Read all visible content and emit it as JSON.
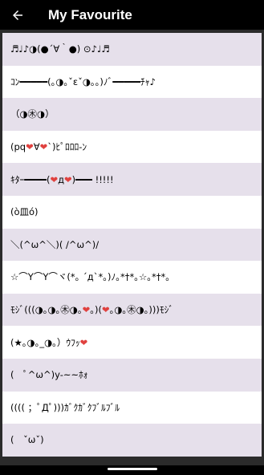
{
  "appbar": {
    "title": "My Favourite",
    "back_icon": "arrow-left-icon"
  },
  "colors": {
    "appbar_bg": "#000000",
    "row_odd": "#e6e0eb",
    "row_even": "#ffffff",
    "heart": "#e0413f"
  },
  "favourites": [
    "♬♩♪◑(●´∀｀●) ⊙♪♩♬",
    "ｺﾝ━━━━━(｡◑｡ˇεˇ◑｡｡)ﾉﾞ━━━━━ﾁｬ♪",
    "（◑㊍◑）",
    "(pq❤∀❤`)ﾋﾟﾛﾛﾛ-ﾝ",
    "ｷﾀｰ━━━━(❤д❤)━━━ !!!!!",
    "(ò皿ó)",
    "＼(^ω^＼)( /^ω^)/",
    "☆⌒Y⌒Y⌒ヾ(*｡ ´д`*｡)ﾉ｡*†*｡☆｡*†*｡",
    "ﾓｼﾞ(((◑｡◑｡㊍◑｡❤｡)(❤｡◑｡㊍◑｡)))ﾓｼﾞ",
    "(★｡◑｡_◑｡）ｳﾌｯ❤",
    "(　ﾟ^ω^)y-~~ﾎｫ",
    "(((( ；ﾟДﾟ)))ｶﾞｸｶﾞｸﾌﾞﾙﾌﾞﾙ",
    "(　ˇωˇ)"
  ]
}
